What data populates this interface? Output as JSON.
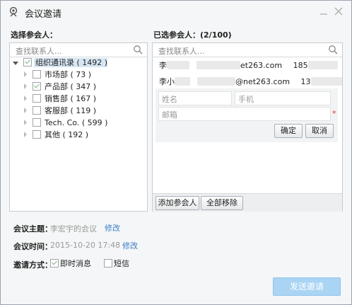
{
  "window": {
    "title": "会议邀请"
  },
  "left": {
    "label": "选择参会人：",
    "search_placeholder": "查找联系人...",
    "tree": [
      {
        "label": "组织通讯录",
        "count": "1492"
      },
      {
        "label": "市场部",
        "count": "73"
      },
      {
        "label": "产品部",
        "count": "347"
      },
      {
        "label": "销售部",
        "count": "167"
      },
      {
        "label": "客服部",
        "count": "119"
      },
      {
        "label": "Tech. Co.",
        "count": "599"
      },
      {
        "label": "其他",
        "count": "192"
      }
    ]
  },
  "right": {
    "label": "已选参会人：(2/100)",
    "search_placeholder": "查找联系人...",
    "selected": [
      {
        "name": "李",
        "email_suffix": "et263.com",
        "phone_prefix": "185"
      },
      {
        "name": "李小",
        "email_suffix": "@net263.com",
        "phone_prefix": "13"
      }
    ],
    "form": {
      "name_placeholder": "姓名",
      "phone_placeholder": "手机",
      "email_placeholder": "邮箱",
      "required_mark": "*",
      "confirm": "确定",
      "cancel": "取消"
    },
    "add_button": "添加参会人",
    "remove_all_button": "全部移除"
  },
  "meeting": {
    "topic_label": "会议主题：",
    "topic_value": "李宏宇的会议",
    "topic_edit": "修改",
    "time_label": "会议时间：",
    "time_value": "2015-10-20 17:48",
    "time_edit": "修改",
    "invite_label": "邀请方式：",
    "option_im": "即时消息",
    "option_sms": "短信"
  },
  "send_button": "发送邀请",
  "colors": {
    "accent": "#3a7ec6",
    "send_bg": "#a9d4f4",
    "required": "#e03030"
  }
}
